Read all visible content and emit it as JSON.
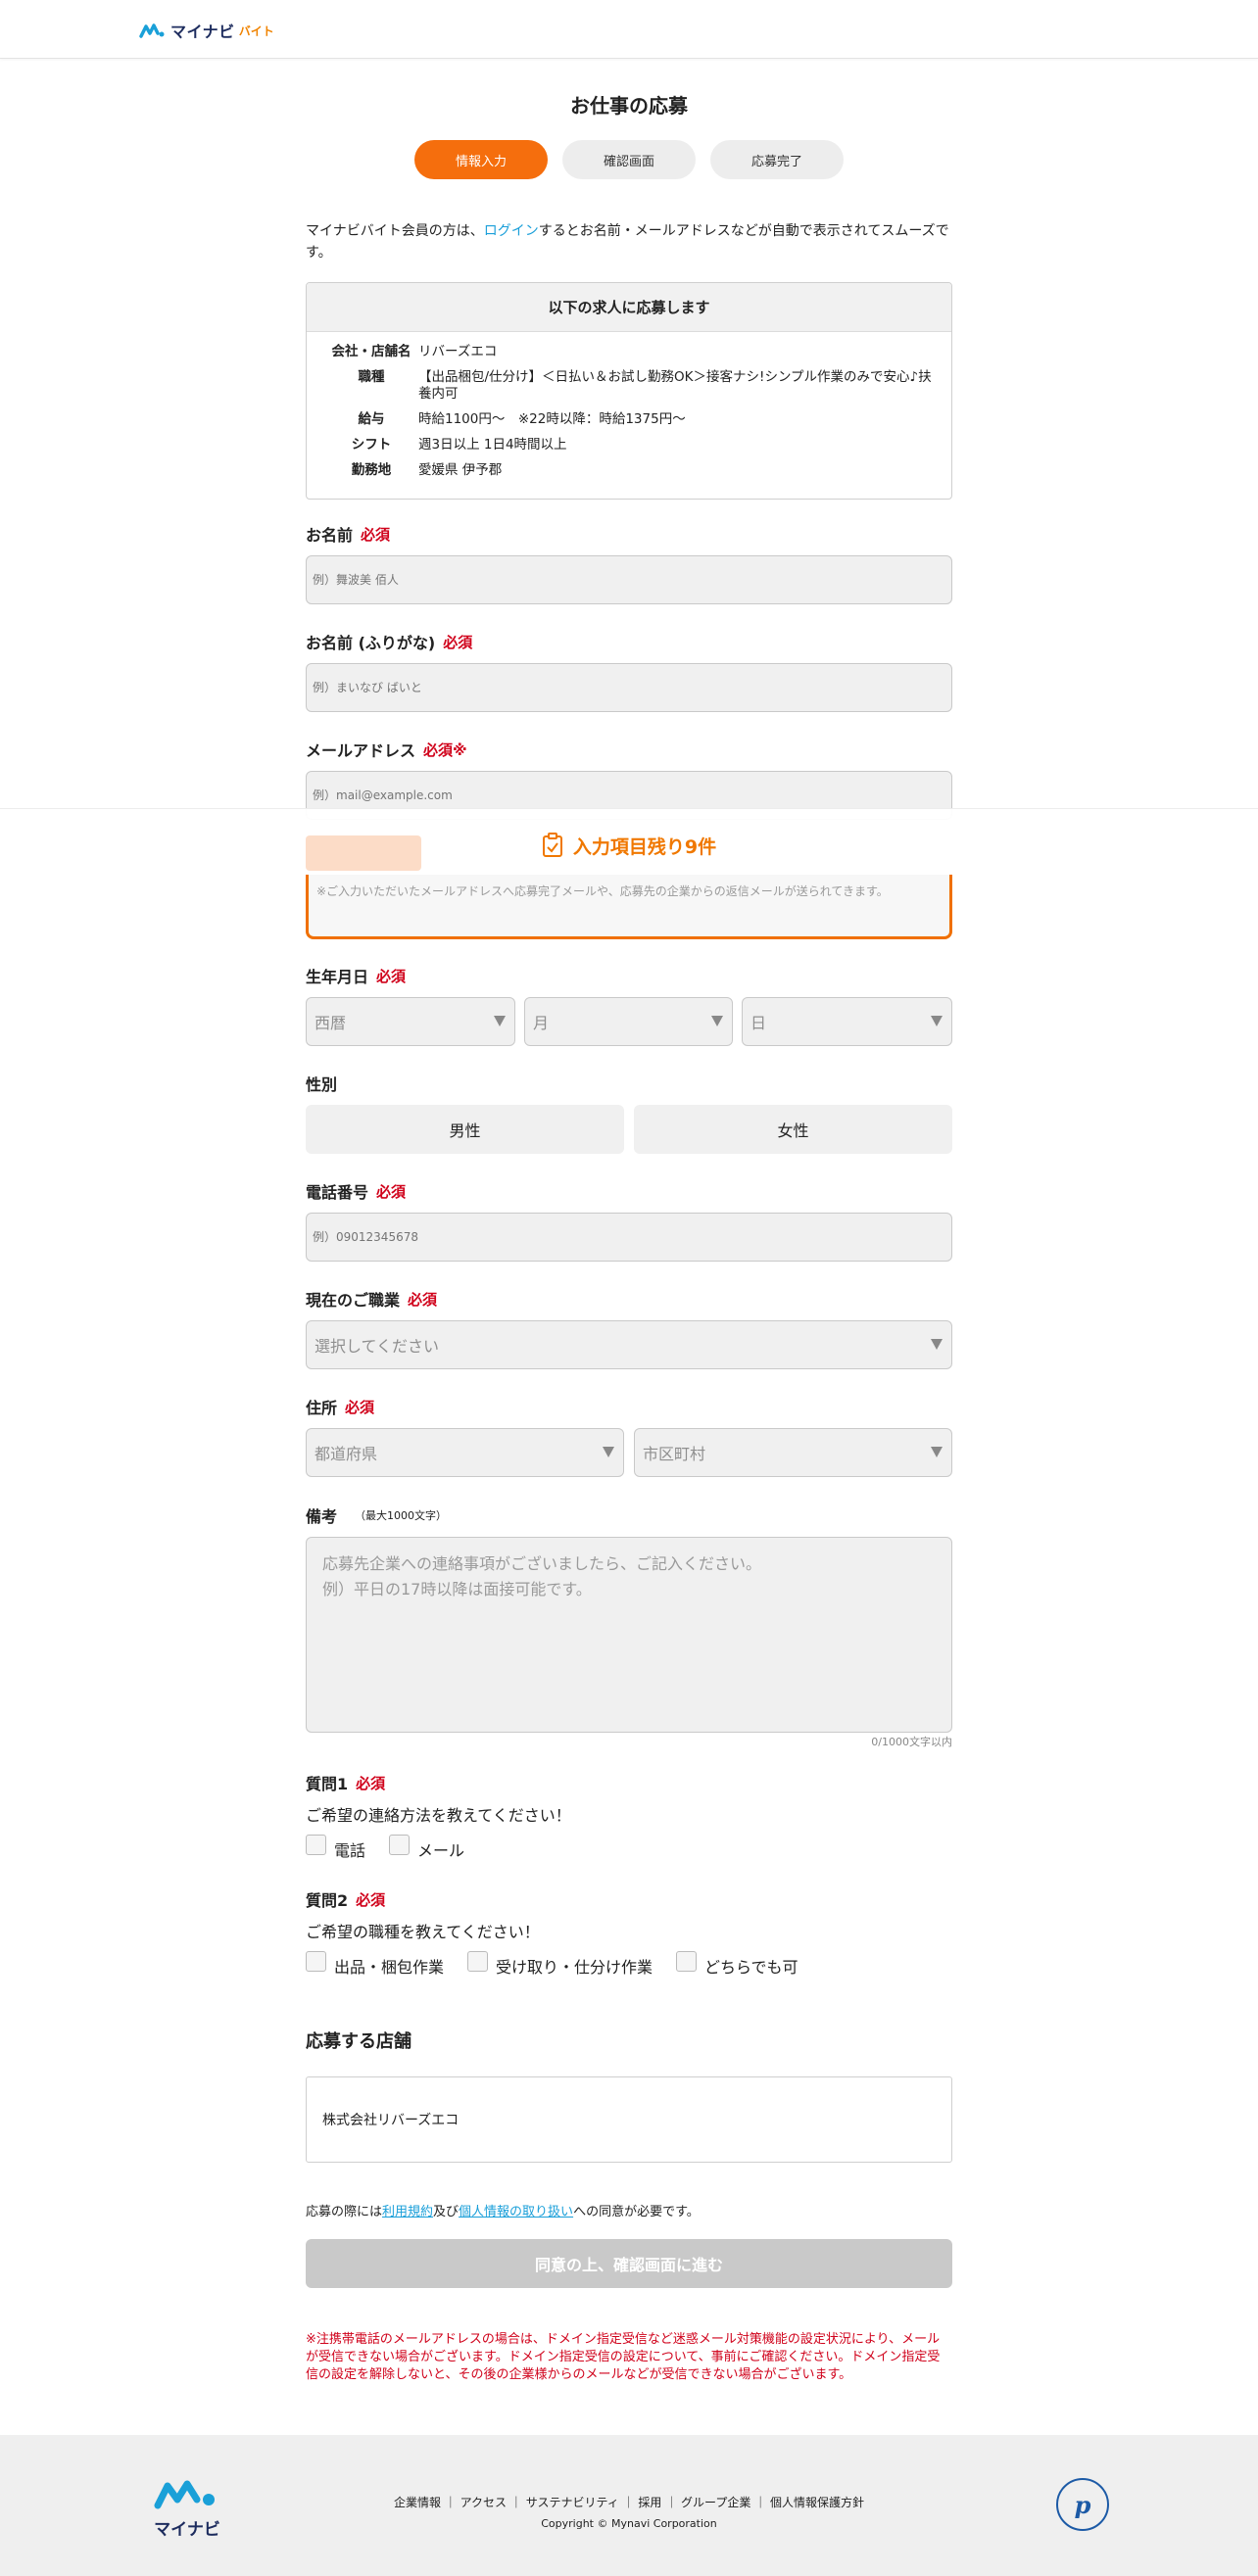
{
  "header": {
    "logo_text": "マイナビ",
    "logo_sub": "バイト"
  },
  "page_title": "お仕事の応募",
  "steps": [
    {
      "label": "情報入力",
      "active": true
    },
    {
      "label": "確認画面",
      "active": false
    },
    {
      "label": "応募完了",
      "active": false
    }
  ],
  "intro": {
    "before": "マイナビバイト会員の方は、",
    "link": "ログイン",
    "after": "するとお名前・メールアドレスなどが自動で表示されてスムーズです。"
  },
  "job": {
    "heading": "以下の求人に応募します",
    "rows": [
      {
        "key": "会社・店舗名",
        "value": "リバーズエコ"
      },
      {
        "key": "職種",
        "value": "【出品梱包/仕分け】＜日払い＆お試し勤務OK＞接客ナシ!シンプル作業のみで安心♪扶養内可"
      },
      {
        "key": "給与",
        "value": "時給1100円〜　※22時以降：時給1375円〜"
      },
      {
        "key": "シフト",
        "value": "週3日以上 1日4時間以上"
      },
      {
        "key": "勤務地",
        "value": "愛媛県 伊予郡"
      }
    ]
  },
  "required_label": "必須",
  "fields": {
    "name": {
      "label": "お名前",
      "placeholder": "例）舞波美 佰人"
    },
    "kana": {
      "label": "お名前 (ふりがな)",
      "placeholder": "例）まいなび ばいと"
    },
    "email": {
      "label": "メールアドレス",
      "mark": "※",
      "placeholder": "例）mail@example.com",
      "note": "※ご入力いただいたメールアドレスへ応募完了メールや、応募先の企業からの返信メールが送られてきます。"
    },
    "birth": {
      "label": "生年月日",
      "year": "西暦",
      "month": "月",
      "day": "日"
    },
    "gender": {
      "label": "性別",
      "male": "男性",
      "female": "女性"
    },
    "phone": {
      "label": "電話番号",
      "placeholder": "例）09012345678"
    },
    "job_status": {
      "label": "現在のご職業",
      "placeholder": "選択してください"
    },
    "address": {
      "label": "住所",
      "prefecture": "都道府県",
      "city": "市区町村"
    },
    "remarks": {
      "label": "備考",
      "limit": "（最大1000文字）",
      "placeholder_1": "応募先企業への連絡事項がございましたら、ご記入ください。",
      "placeholder_2": "例）平日の17時以降は面接可能です。",
      "counter": "0/1000文字以内"
    }
  },
  "sticky": {
    "text": "入力項目残り9件"
  },
  "questions": [
    {
      "label": "質問1",
      "text": "ご希望の連絡方法を教えてください！",
      "options": [
        "電話",
        "メール"
      ]
    },
    {
      "label": "質問2",
      "text": "ご希望の職種を教えてください！",
      "options": [
        "出品・梱包作業",
        "受け取り・仕分け作業",
        "どちらでも可"
      ]
    }
  ],
  "store": {
    "title": "応募する店舗",
    "name": "株式会社リバーズエコ"
  },
  "agreement": {
    "prefix": "応募の際には",
    "terms": "利用規約",
    "and": "及び",
    "privacy": "個人情報の取り扱い",
    "suffix": "への同意が必要です。"
  },
  "submit_label": "同意の上、確認画面に進む",
  "warning": "※注携帯電話のメールアドレスの場合は、ドメイン指定受信など迷惑メール対策機能の設定状況により、メールが受信できない場合がございます。ドメイン指定受信の設定について、事前にご確認ください。ドメイン指定受信の設定を解除しないと、その後の企業様からのメールなどが受信できない場合がございます。",
  "footer": {
    "logo_text": "マイナビ",
    "links": [
      "企業情報",
      "アクセス",
      "サステナビリティ",
      "採用",
      "グループ企業",
      "個人情報保護方針"
    ],
    "copyright": "Copyright © Mynavi Corporation"
  },
  "colors": {
    "accent": "#f56e0d",
    "required": "#d0021b",
    "link": "#1a9fd9"
  }
}
